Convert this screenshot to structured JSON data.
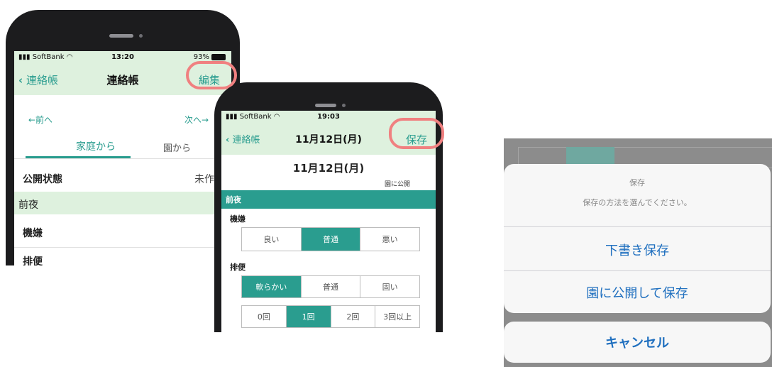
{
  "phone1": {
    "status": {
      "carrier": "SoftBank",
      "time": "13:20",
      "battery": "93%"
    },
    "nav": {
      "back": "連絡帳",
      "title": "連絡帳",
      "action": "編集"
    },
    "pager": {
      "prev": "←前へ",
      "next": "次へ→"
    },
    "tabs": {
      "home": "家庭から",
      "school": "園から"
    },
    "publish": {
      "label": "公開状態",
      "value": "未作成"
    },
    "section": "前夜",
    "fields": {
      "mood": "機嫌",
      "bowel": "排便"
    }
  },
  "phone2": {
    "status": {
      "carrier": "SoftBank",
      "time": "19:03"
    },
    "nav": {
      "back": "連絡帳",
      "title": "11月12日(月)",
      "action": "保存"
    },
    "date_heading": "11月12日(月)",
    "publish_note": "園に公開",
    "section": "前夜",
    "mood": {
      "label": "機嫌",
      "options": [
        "良い",
        "普通",
        "悪い"
      ]
    },
    "bowel": {
      "label": "排便",
      "texture": [
        "軟らかい",
        "普通",
        "固い"
      ],
      "count": [
        "0回",
        "1回",
        "2回",
        "3回以上"
      ]
    }
  },
  "action_sheet": {
    "title": "保存",
    "subtitle": "保存の方法を選んでください。",
    "draft": "下書き保存",
    "publish": "園に公開して保存",
    "cancel": "キャンセル"
  },
  "colors": {
    "accent": "#2a9d8f",
    "nav_bg": "#def1de",
    "highlight": "#f08080",
    "ios_blue": "#1f6fbf"
  },
  "icons": [
    "chevron-left-icon",
    "wifi-icon",
    "signal-icon",
    "battery-icon"
  ]
}
